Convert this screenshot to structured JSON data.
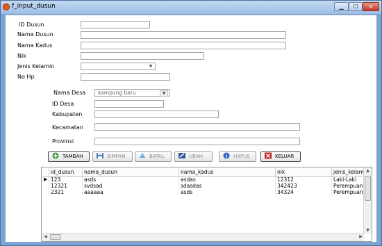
{
  "window": {
    "title": "f_input_dusun",
    "controls": [
      "minimize",
      "maximize",
      "close"
    ]
  },
  "form_top": {
    "id_dusun_label": "ID Dusun",
    "nama_dusun_label": "Nama Dusun",
    "nama_kadus_label": "Nama Kadus",
    "nik_label": "Nik",
    "jenis_kelamin_label": "Jenis Kelamin",
    "no_hp_label": "No Hp",
    "id_dusun_value": "",
    "nama_dusun_value": "",
    "nama_kadus_value": "",
    "nik_value": "",
    "jenis_kelamin_value": "",
    "no_hp_value": ""
  },
  "form_desa": {
    "nama_desa_label": "Nama Desa",
    "nama_desa_value": "kampung baru",
    "id_desa_label": "ID Desa",
    "kabupaten_label": "Kabupaten",
    "kecamatan_label": "Kecamatan",
    "provinsi_label": "Provinsi",
    "id_desa_value": "",
    "kabupaten_value": "",
    "kecamatan_value": "",
    "provinsi_value": ""
  },
  "buttons": {
    "tambah": "TAMBAH",
    "simpan": "SIMPAN",
    "batal": "BATAL",
    "ubah": "UBAH",
    "hapus": "HAPUS",
    "keluar": "KELUAR"
  },
  "grid": {
    "columns": [
      "id_dusun",
      "nama_dusun",
      "nama_kadus",
      "nik",
      "jenis_kelamin"
    ],
    "rows": [
      [
        "123",
        "asds",
        "asdas",
        "12312",
        "Laki-Laki"
      ],
      [
        "12321",
        "svdsad",
        "sdasdas",
        "342423",
        "Perempuan"
      ],
      [
        "2321",
        "aaaaaa",
        "asds",
        "34324",
        "Perempuan"
      ]
    ],
    "current_row_indicator": "▶"
  },
  "icons": {
    "tambah": "add-icon",
    "simpan": "save-icon",
    "batal": "cancel-icon",
    "ubah": "edit-icon",
    "hapus": "info-icon",
    "keluar": "exit-icon"
  },
  "colors": {
    "window_frame": "#7aa4d6",
    "close_button": "#c0392b",
    "tambah_icon": "#3a8f3a",
    "keluar_icon": "#cc2222"
  }
}
